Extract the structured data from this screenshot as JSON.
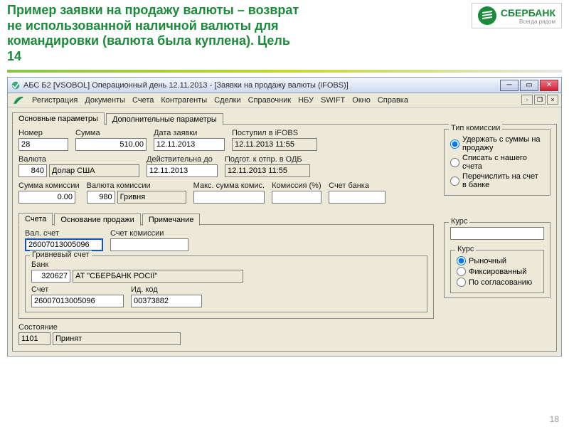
{
  "slide": {
    "title_l1": "Пример заявки на продажу валюты – возврат",
    "title_l2": "не использованной наличной валюты для",
    "title_l3": "командировки (валюта была куплена). Цель",
    "title_l4": "14",
    "logo_text": "СБЕРБАНК",
    "logo_sub": "Всегда рядом",
    "page_num": "18"
  },
  "window": {
    "title": "АБС Б2 [VSOBOL] Операционный день 12.11.2013 - [Заявки на продажу валюты (iFOBS)]"
  },
  "menu": {
    "m1": "Регистрация",
    "m2": "Документы",
    "m3": "Счета",
    "m4": "Контрагенты",
    "m5": "Сделки",
    "m6": "Справочник",
    "m7": "НБУ",
    "m8": "SWIFT",
    "m9": "Окно",
    "m10": "Справка"
  },
  "tabs": {
    "main": "Основные параметры",
    "extra": "Дополнительные параметры"
  },
  "fields": {
    "number_lbl": "Номер",
    "number_val": "28",
    "sum_lbl": "Сумма",
    "sum_val": "510.00",
    "date_lbl": "Дата заявки",
    "date_val": "12.11.2013",
    "ifobs_lbl": "Поступил в iFOBS",
    "ifobs_val": "12.11.2013 11:55",
    "currency_lbl": "Валюта",
    "currency_code": "840",
    "currency_name": "Долар США",
    "valid_lbl": "Действительна до",
    "valid_val": "12.11.2013",
    "odb_lbl": "Подгот. к отпр. в ОДБ",
    "odb_val": "12.11.2013 11:55",
    "comm_sum_lbl": "Сумма комиссии",
    "comm_sum_val": "0.00",
    "comm_cur_lbl": "Валюта комиссии",
    "comm_cur_code": "980",
    "comm_cur_name": "Гривня",
    "max_comm_lbl": "Макс. сумма комис.",
    "max_comm_val": "",
    "comm_pct_lbl": "Комиссия (%)",
    "comm_pct_val": "",
    "bank_acc_lbl": "Счет банка",
    "bank_acc_val": ""
  },
  "comm_type": {
    "legend": "Тип комиссии",
    "o1": "Удержать с суммы на продажу",
    "o2": "Списать с нашего счета",
    "o3": "Перечислить на счет в банке"
  },
  "subtabs": {
    "t1": "Счета",
    "t2": "Основание продажи",
    "t3": "Примечание"
  },
  "accounts": {
    "val_acc_lbl": "Вал. счет",
    "val_acc_val": "26007013005096",
    "comm_acc_lbl": "Счет комиссии",
    "comm_acc_val": "",
    "uah_group": "Гривневый счет",
    "bank_lbl": "Банк",
    "bank_code": "320627",
    "bank_name": "АТ \"СБЕРБАНК РОСІЇ\"",
    "acc_lbl": "Счет",
    "acc_val": "26007013005096",
    "id_lbl": "Ид. код",
    "id_val": "00373882"
  },
  "kurs": {
    "legend_outer": "Курс",
    "value": "",
    "legend_inner": "Курс",
    "o1": "Рыночный",
    "o2": "Фиксированный",
    "o3": "По согласованию"
  },
  "state": {
    "lbl": "Состояние",
    "code": "1101",
    "name": "Принят"
  }
}
